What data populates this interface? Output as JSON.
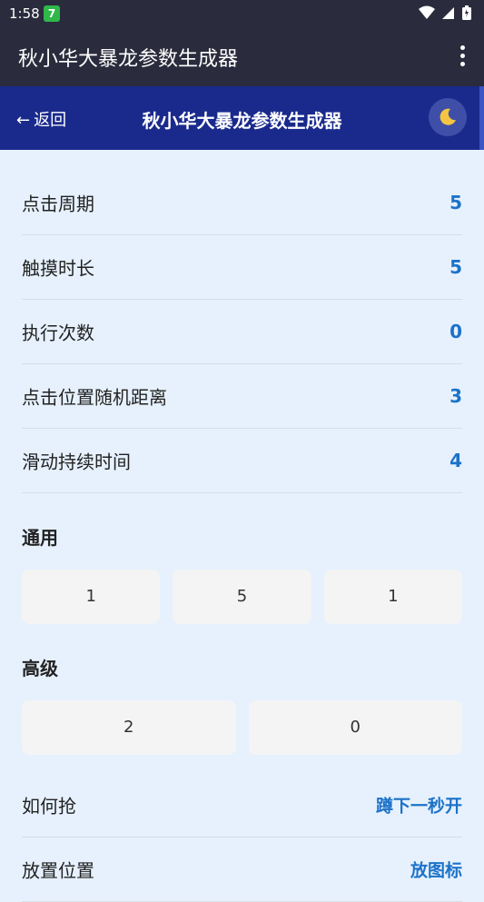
{
  "status_bar": {
    "time": "1:58",
    "app_badge": "7"
  },
  "app_bar": {
    "title": "秋小华大暴龙参数生成器"
  },
  "web_header": {
    "back_arrow": "←",
    "back_label": "返回",
    "title": "秋小华大暴龙参数生成器",
    "theme_icon": "moon-icon"
  },
  "params": [
    {
      "label": "点击周期",
      "value": "5"
    },
    {
      "label": "触摸时长",
      "value": "5"
    },
    {
      "label": "执行次数",
      "value": "0"
    },
    {
      "label": "点击位置随机距离",
      "value": "3"
    },
    {
      "label": "滑动持续时间",
      "value": "4"
    }
  ],
  "general": {
    "title": "通用",
    "options": [
      "1",
      "5",
      "1"
    ]
  },
  "advanced": {
    "title": "高级",
    "options": [
      "2",
      "0"
    ]
  },
  "actions": [
    {
      "label": "如何抢",
      "value": "蹲下一秒开"
    },
    {
      "label": "放置位置",
      "value": "放图标"
    }
  ],
  "colors": {
    "accent": "#1c72c8",
    "header": "#1a2a8c",
    "appbar": "#2a2b3c",
    "background": "#e6f1fd"
  }
}
